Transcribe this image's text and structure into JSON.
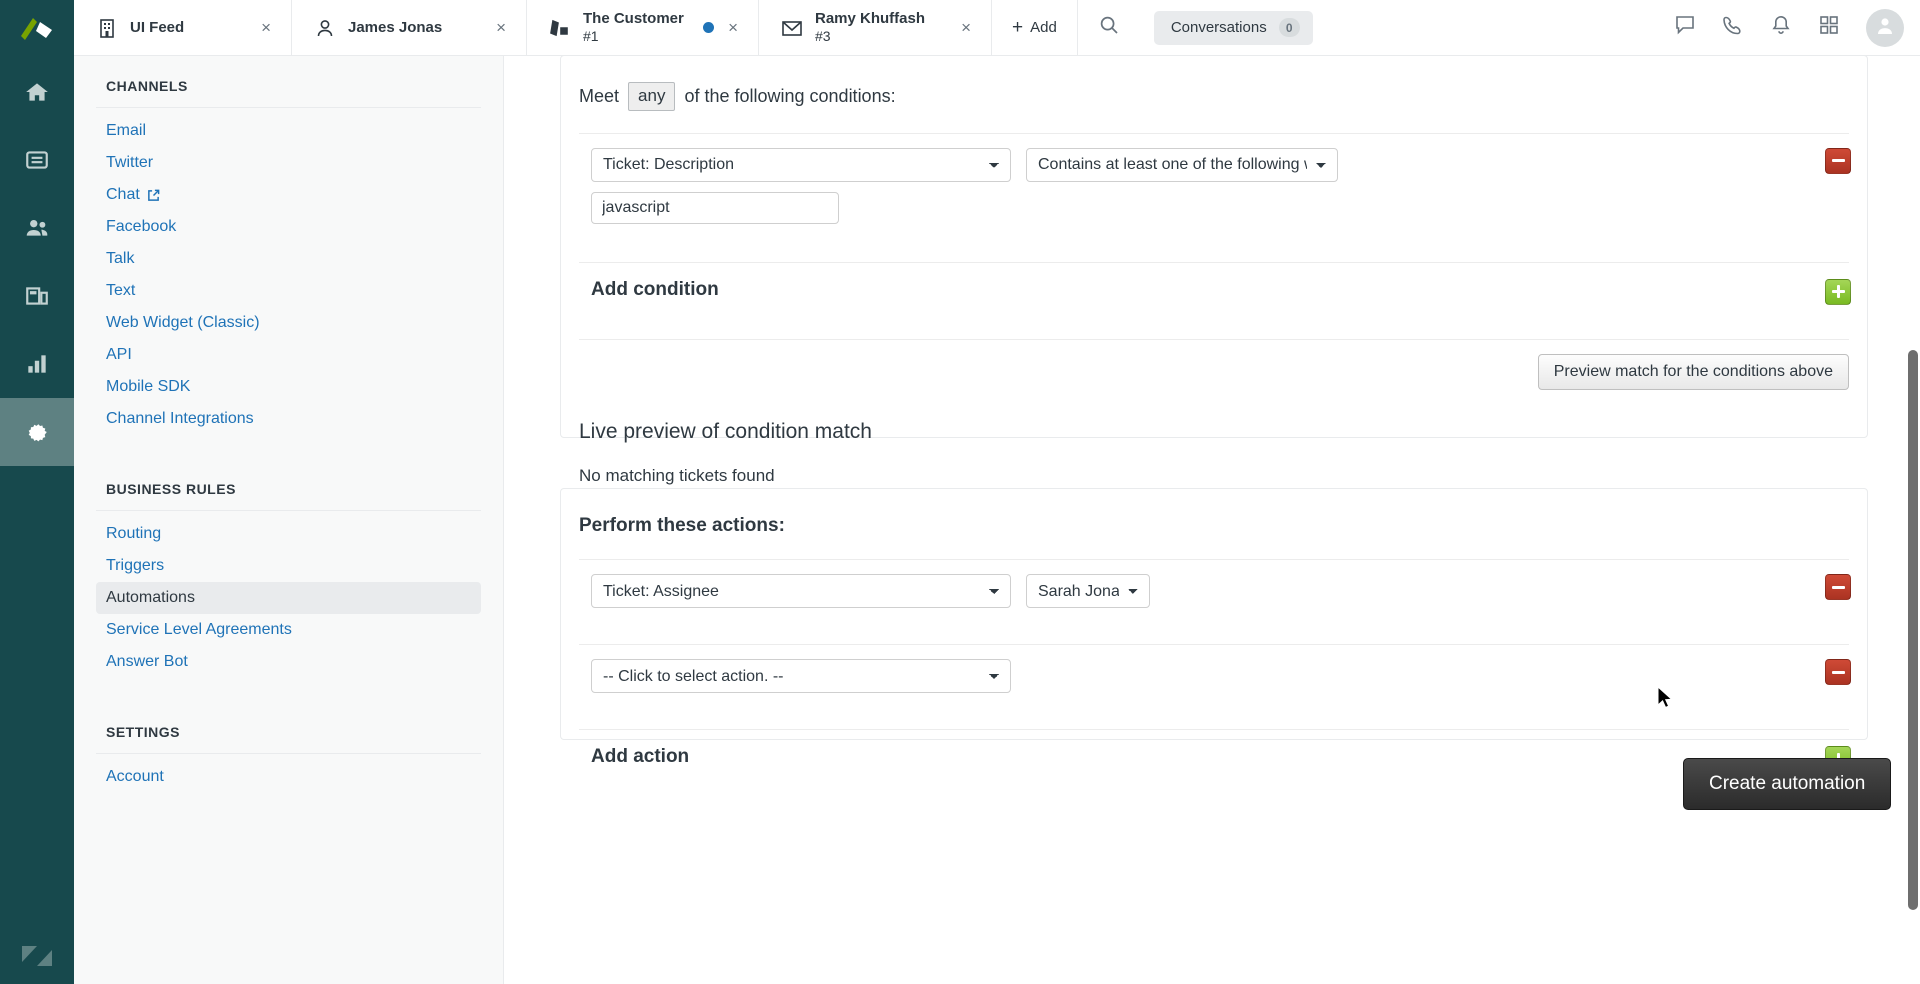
{
  "app": {
    "brand_dark": "#17494d",
    "accent_link": "#1f73b7",
    "minus_color": "#b83a2b",
    "plus_color": "#8dc63f"
  },
  "rail": {
    "items": [
      {
        "icon": "zendesk-logo-icon",
        "label": "Zendesk"
      },
      {
        "icon": "home-icon",
        "label": "Home"
      },
      {
        "icon": "views-icon",
        "label": "Views"
      },
      {
        "icon": "customers-icon",
        "label": "Customers"
      },
      {
        "icon": "organizations-icon",
        "label": "Organizations"
      },
      {
        "icon": "reporting-icon",
        "label": "Reporting"
      },
      {
        "icon": "gear-icon",
        "label": "Admin",
        "active": true
      }
    ],
    "footer_icon": "zendesk-wordmark-icon"
  },
  "topbar": {
    "tabs": [
      {
        "icon": "organization-icon",
        "title": "UI Feed",
        "sub": "",
        "dot": false,
        "close": "×"
      },
      {
        "icon": "user-icon",
        "title": "James Jonas",
        "sub": "",
        "dot": false,
        "close": "×"
      },
      {
        "icon": "ticket-icon",
        "title": "The Customer",
        "sub": "#1",
        "dot": true,
        "close": "×"
      },
      {
        "icon": "mail-icon",
        "title": "Ramy Khuffash",
        "sub": "#3",
        "dot": false,
        "close": "×"
      }
    ],
    "add_label": "Add",
    "add_plus": "+",
    "search_icon": "search-icon",
    "conversations": {
      "label": "Conversations",
      "count": "0"
    },
    "actions": [
      {
        "icon": "chat-bubble-icon",
        "label": "Chat"
      },
      {
        "icon": "phone-icon",
        "label": "Talk"
      },
      {
        "icon": "bell-icon",
        "label": "Notifications"
      },
      {
        "icon": "apps-grid-icon",
        "label": "Apps"
      }
    ],
    "avatar_icon": "avatar-icon"
  },
  "nav": {
    "sections": [
      {
        "heading": "CHANNELS",
        "items": [
          {
            "label": "Email",
            "external": false
          },
          {
            "label": "Twitter",
            "external": false
          },
          {
            "label": "Chat",
            "external": true
          },
          {
            "label": "Facebook",
            "external": false
          },
          {
            "label": "Talk",
            "external": false
          },
          {
            "label": "Text",
            "external": false
          },
          {
            "label": "Web Widget (Classic)",
            "external": false
          },
          {
            "label": "API",
            "external": false
          },
          {
            "label": "Mobile SDK",
            "external": false
          },
          {
            "label": "Channel Integrations",
            "external": false
          }
        ]
      },
      {
        "heading": "BUSINESS RULES",
        "items": [
          {
            "label": "Routing",
            "external": false
          },
          {
            "label": "Triggers",
            "external": false
          },
          {
            "label": "Automations",
            "external": false,
            "active": true
          },
          {
            "label": "Service Level Agreements",
            "external": false
          },
          {
            "label": "Answer Bot",
            "external": false
          }
        ]
      },
      {
        "heading": "SETTINGS",
        "items": [
          {
            "label": "Account",
            "external": false
          }
        ]
      }
    ]
  },
  "conditions": {
    "meet_prefix": "Meet",
    "meet_operator": "any",
    "meet_suffix": "of the following conditions:",
    "rows": [
      {
        "field_value": "Ticket: Description",
        "operator_value": "Contains at least one of the following words",
        "text_value": "javascript",
        "remove_label": "−"
      }
    ],
    "add_label": "Add condition",
    "add_glyph": "+",
    "preview_button": "Preview match for the conditions above",
    "live_title": "Live preview of condition match",
    "live_empty": "No matching tickets found"
  },
  "actions": {
    "title": "Perform these actions:",
    "rows": [
      {
        "field_value": "Ticket: Assignee",
        "value_value": "Sarah Jonas",
        "remove_label": "−"
      },
      {
        "field_value": "-- Click to select action. --",
        "value_value": null,
        "remove_label": "−"
      }
    ],
    "add_label": "Add action",
    "add_glyph": "+"
  },
  "footer": {
    "create_label": "Create automation"
  }
}
